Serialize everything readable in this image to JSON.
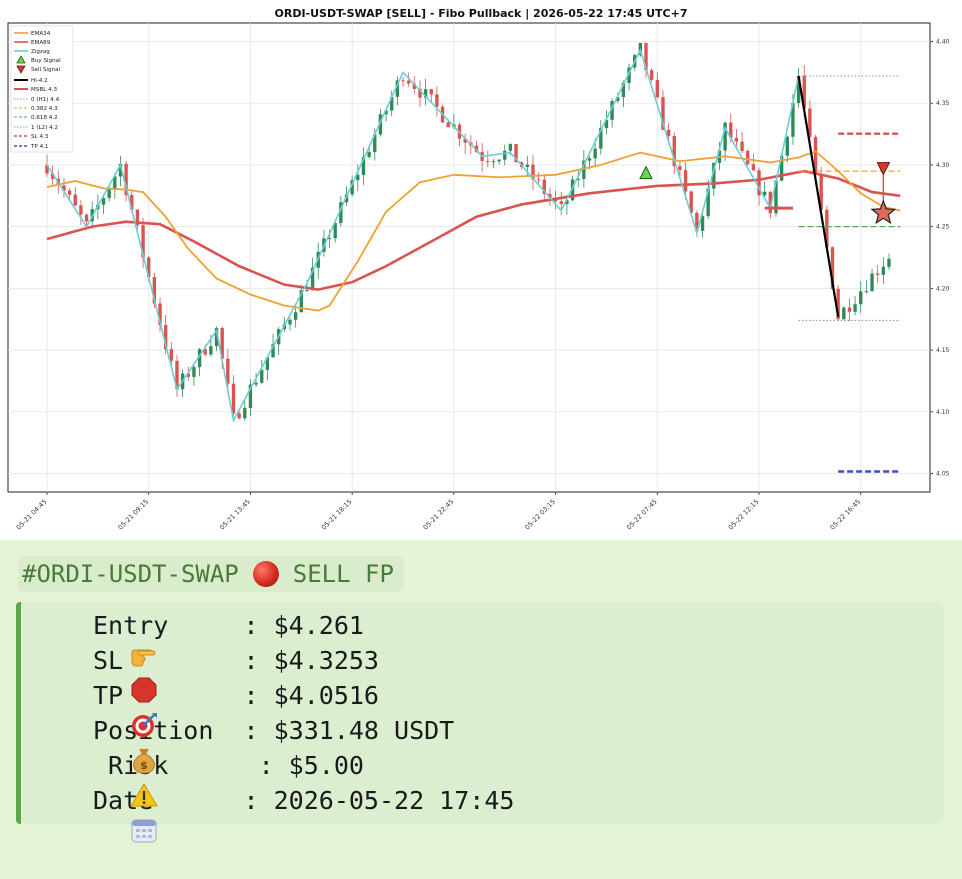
{
  "chart_data": {
    "type": "candlestick",
    "title": "ORDI-USDT-SWAP  [SELL] - Fibo Pullback  |  2026-05-22 17:45 UTC+7",
    "ylim": [
      4.035,
      4.415
    ],
    "yticks": [
      "4.40",
      "4.35",
      "4.30",
      "4.25",
      "4.20",
      "4.15",
      "4.10",
      "4.05"
    ],
    "ytick_values": [
      4.4,
      4.35,
      4.3,
      4.25,
      4.2,
      4.15,
      4.1,
      4.05
    ],
    "xticks": [
      "05-21 04:45",
      "05-21 09:15",
      "05-21 13:45",
      "05-21 18:15",
      "05-21 22:45",
      "05-22 03:15",
      "05-22 07:45",
      "05-22 12:15",
      "05-22 16:45"
    ],
    "xtick_index": [
      0,
      18,
      36,
      54,
      72,
      90,
      108,
      126,
      144
    ],
    "n_candles": 150,
    "grid": true,
    "legend": "top-left",
    "legend_entries": [
      "EMA34",
      "EMA89",
      "Zigzag",
      "Buy Signal",
      "Sell Signal",
      "Hi-4.2",
      "MSBL 4.3",
      "0 (H1) 4.4",
      "0.382 4.3",
      "0.618 4.2",
      "1 (L2) 4.2",
      "SL 4.3",
      "TP 4.1"
    ],
    "colors": {
      "up": "#2e8b57",
      "down": "#d9534f",
      "ema34": "#f0a030",
      "ema89": "#d9534f",
      "zigzag": "#6ccdd4",
      "fib0": "#999999",
      "fib382": "#f0a030",
      "fib618": "#4caf50",
      "sl": "#d9534f",
      "tp": "#3b4fc4",
      "hl": "#000000"
    },
    "zigzag": [
      {
        "i": 0,
        "v": 4.3
      },
      {
        "i": 7,
        "v": 4.25
      },
      {
        "i": 13,
        "v": 4.3
      },
      {
        "i": 23,
        "v": 4.118
      },
      {
        "i": 30,
        "v": 4.166
      },
      {
        "i": 33,
        "v": 4.093
      },
      {
        "i": 46,
        "v": 4.204
      },
      {
        "i": 63,
        "v": 4.375
      },
      {
        "i": 77,
        "v": 4.307
      },
      {
        "i": 82,
        "v": 4.31
      },
      {
        "i": 91,
        "v": 4.263
      },
      {
        "i": 105,
        "v": 4.393
      },
      {
        "i": 115,
        "v": 4.245
      },
      {
        "i": 120,
        "v": 4.33
      },
      {
        "i": 128,
        "v": 4.265
      },
      {
        "i": 133,
        "v": 4.372
      },
      {
        "i": 140,
        "v": 4.177
      }
    ],
    "ema34": [
      {
        "i": 0,
        "v": 4.282
      },
      {
        "i": 5,
        "v": 4.287
      },
      {
        "i": 10,
        "v": 4.281
      },
      {
        "i": 14,
        "v": 4.28
      },
      {
        "i": 17,
        "v": 4.278
      },
      {
        "i": 21,
        "v": 4.258
      },
      {
        "i": 25,
        "v": 4.232
      },
      {
        "i": 30,
        "v": 4.208
      },
      {
        "i": 36,
        "v": 4.195
      },
      {
        "i": 42,
        "v": 4.186
      },
      {
        "i": 48,
        "v": 4.182
      },
      {
        "i": 50,
        "v": 4.186
      },
      {
        "i": 55,
        "v": 4.222
      },
      {
        "i": 60,
        "v": 4.262
      },
      {
        "i": 66,
        "v": 4.286
      },
      {
        "i": 72,
        "v": 4.292
      },
      {
        "i": 80,
        "v": 4.29
      },
      {
        "i": 90,
        "v": 4.292
      },
      {
        "i": 98,
        "v": 4.3
      },
      {
        "i": 105,
        "v": 4.31
      },
      {
        "i": 112,
        "v": 4.303
      },
      {
        "i": 120,
        "v": 4.307
      },
      {
        "i": 128,
        "v": 4.302
      },
      {
        "i": 133,
        "v": 4.306
      },
      {
        "i": 136,
        "v": 4.311
      },
      {
        "i": 140,
        "v": 4.295
      },
      {
        "i": 144,
        "v": 4.277
      },
      {
        "i": 148,
        "v": 4.266
      },
      {
        "i": 151,
        "v": 4.263
      }
    ],
    "ema89": [
      {
        "i": 0,
        "v": 4.24
      },
      {
        "i": 8,
        "v": 4.25
      },
      {
        "i": 14,
        "v": 4.254
      },
      {
        "i": 20,
        "v": 4.252
      },
      {
        "i": 26,
        "v": 4.238
      },
      {
        "i": 34,
        "v": 4.218
      },
      {
        "i": 42,
        "v": 4.203
      },
      {
        "i": 48,
        "v": 4.199
      },
      {
        "i": 54,
        "v": 4.205
      },
      {
        "i": 60,
        "v": 4.218
      },
      {
        "i": 68,
        "v": 4.238
      },
      {
        "i": 76,
        "v": 4.258
      },
      {
        "i": 84,
        "v": 4.268
      },
      {
        "i": 96,
        "v": 4.277
      },
      {
        "i": 108,
        "v": 4.283
      },
      {
        "i": 118,
        "v": 4.285
      },
      {
        "i": 126,
        "v": 4.288
      },
      {
        "i": 134,
        "v": 4.295
      },
      {
        "i": 140,
        "v": 4.289
      },
      {
        "i": 146,
        "v": 4.278
      },
      {
        "i": 151,
        "v": 4.275
      }
    ],
    "fib_lines": [
      {
        "name": "0 (H1)",
        "value": 4.372,
        "i0": 133,
        "i1": 151,
        "style": "dotted",
        "color_key": "fib0"
      },
      {
        "name": "0.382",
        "value": 4.295,
        "i0": 133,
        "i1": 151,
        "style": "dashed",
        "color_key": "fib382"
      },
      {
        "name": "0.618",
        "value": 4.25,
        "i0": 133,
        "i1": 151,
        "style": "dashed",
        "color_key": "fib618"
      },
      {
        "name": "1 (L2)",
        "value": 4.174,
        "i0": 133,
        "i1": 151,
        "style": "dotted",
        "color_key": "fib0"
      },
      {
        "name": "SL",
        "value": 4.3253,
        "i0": 140,
        "i1": 151,
        "style": "dashed",
        "color_key": "sl"
      },
      {
        "name": "TP",
        "value": 4.0516,
        "i0": 140,
        "i1": 151,
        "style": "dashed",
        "color_key": "tp"
      }
    ],
    "msbl": {
      "value": 4.265,
      "i0": 127,
      "i1": 132
    },
    "hl_line": [
      {
        "i": 133,
        "v": 4.372
      },
      {
        "i": 140,
        "v": 4.177
      }
    ],
    "buy_signal": {
      "i": 106,
      "v": 4.293
    },
    "sell_signal": {
      "i": 148,
      "v": 4.297
    },
    "entry_star": {
      "i": 148,
      "v": 4.261
    }
  },
  "message": {
    "hashtag": "#ORDI-USDT-SWAP",
    "signal_label": "SELL FP",
    "rows": [
      {
        "icon": "pointing-hand-icon",
        "label": "Entry    ",
        "value": " : $4.261"
      },
      {
        "icon": "stop-sign-icon",
        "label": "SL       ",
        "value": " : $4.3253"
      },
      {
        "icon": "target-icon",
        "label": "TP       ",
        "value": " : $4.0516"
      },
      {
        "icon": "money-bag-icon",
        "label": "Position ",
        "value": " : $331.48 USDT"
      },
      {
        "icon": "warning-icon",
        "label": " Risk     ",
        "value": " : $5.00"
      },
      {
        "icon": "calendar-icon",
        "label": "Date     ",
        "value": " : 2026-05-22 17:45"
      }
    ]
  }
}
